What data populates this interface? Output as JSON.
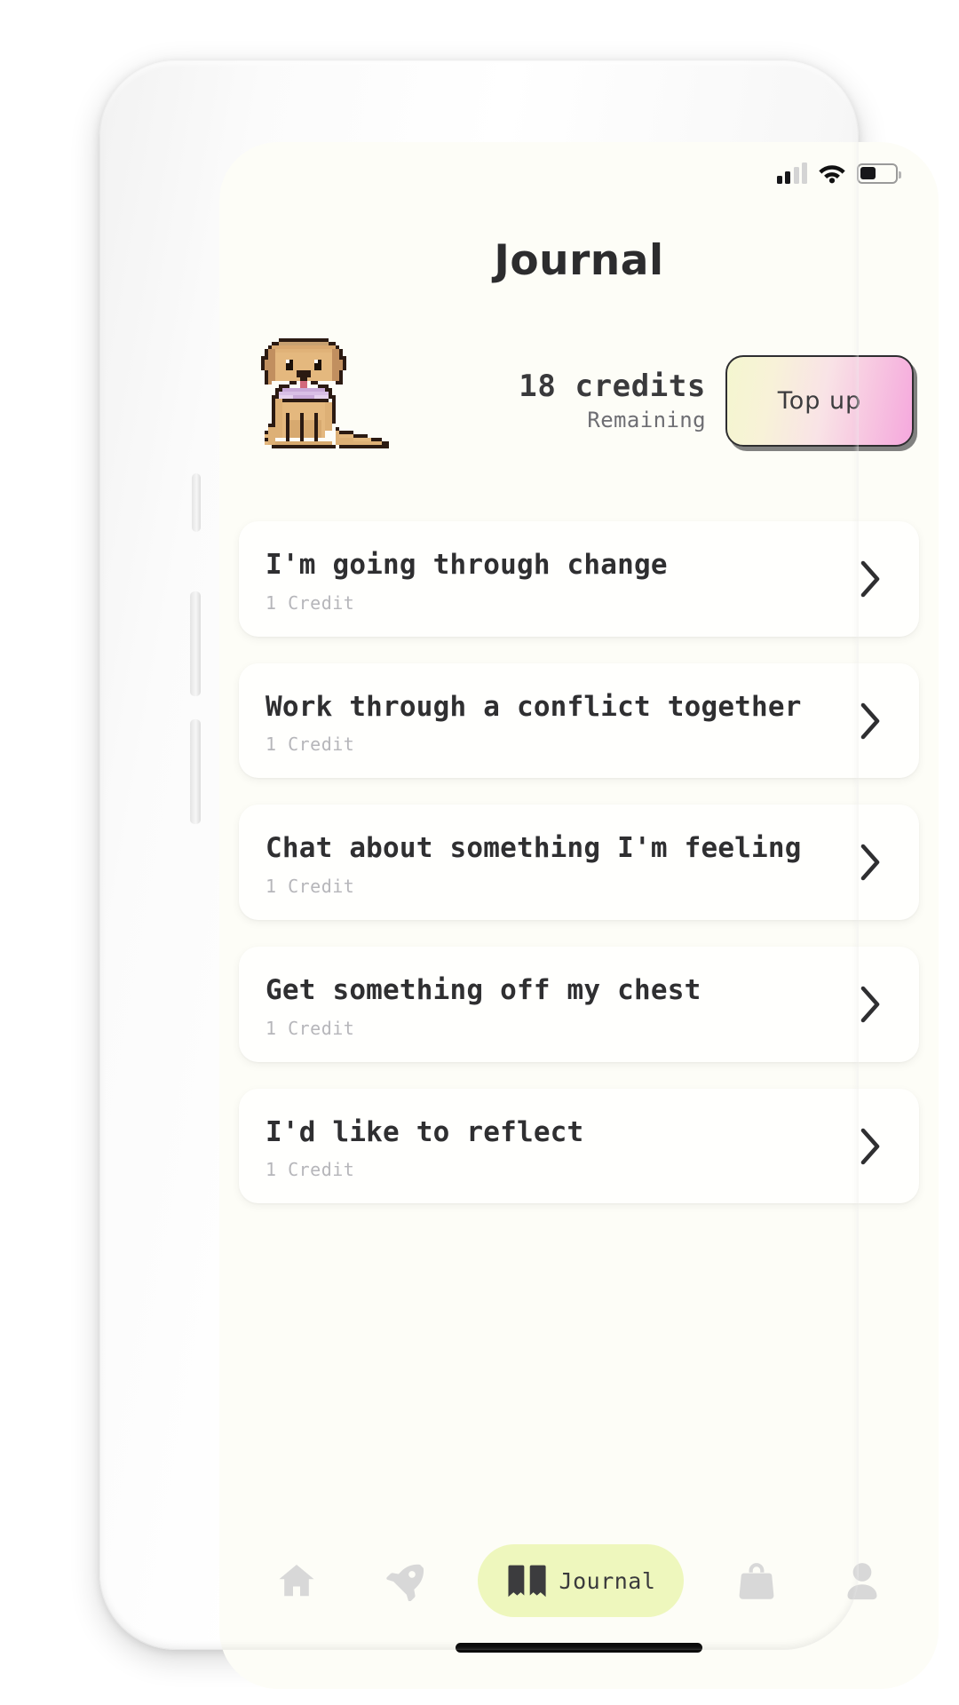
{
  "statusbar": {
    "signal_icon": "signal-bars-icon",
    "signal_bars_total": 4,
    "signal_bars_active": 2,
    "wifi_icon": "wifi-icon",
    "battery_icon": "battery-icon",
    "battery_percent": 45
  },
  "header": {
    "title": "Journal"
  },
  "credits": {
    "mascot_icon": "pixel-dog-icon",
    "amount_label": "18 credits",
    "status_label": "Remaining",
    "topup_label": "Top up",
    "gradient_start": "#f4f6cf",
    "gradient_end": "#f5a8dd",
    "border_color": "#2e2e30"
  },
  "cards": [
    {
      "title": "I'm going through change",
      "cost": "1 Credit",
      "chevron_icon": "chevron-right-icon"
    },
    {
      "title": "Work through a conflict together",
      "cost": "1 Credit",
      "chevron_icon": "chevron-right-icon"
    },
    {
      "title": "Chat about something I'm feeling",
      "cost": "1 Credit",
      "chevron_icon": "chevron-right-icon"
    },
    {
      "title": "Get something off my chest",
      "cost": "1 Credit",
      "chevron_icon": "chevron-right-icon"
    },
    {
      "title": "I'd like to reflect",
      "cost": "1 Credit",
      "chevron_icon": "chevron-right-icon"
    }
  ],
  "tabbar": {
    "active_color": "#eef7bd",
    "inactive_color": "#d8d8d8",
    "items": [
      {
        "id": "home",
        "icon": "home-icon",
        "label": "",
        "active": false
      },
      {
        "id": "explore",
        "icon": "rocket-icon",
        "label": "",
        "active": false
      },
      {
        "id": "journal",
        "icon": "open-book-icon",
        "label": "Journal",
        "active": true
      },
      {
        "id": "shop",
        "icon": "shopping-bag-icon",
        "label": "",
        "active": false
      },
      {
        "id": "profile",
        "icon": "person-icon",
        "label": "",
        "active": false
      }
    ]
  },
  "device": {
    "home_indicator": "home-indicator",
    "buttons": [
      "silent-switch",
      "volume-up-button",
      "volume-down-button",
      "power-button"
    ]
  }
}
